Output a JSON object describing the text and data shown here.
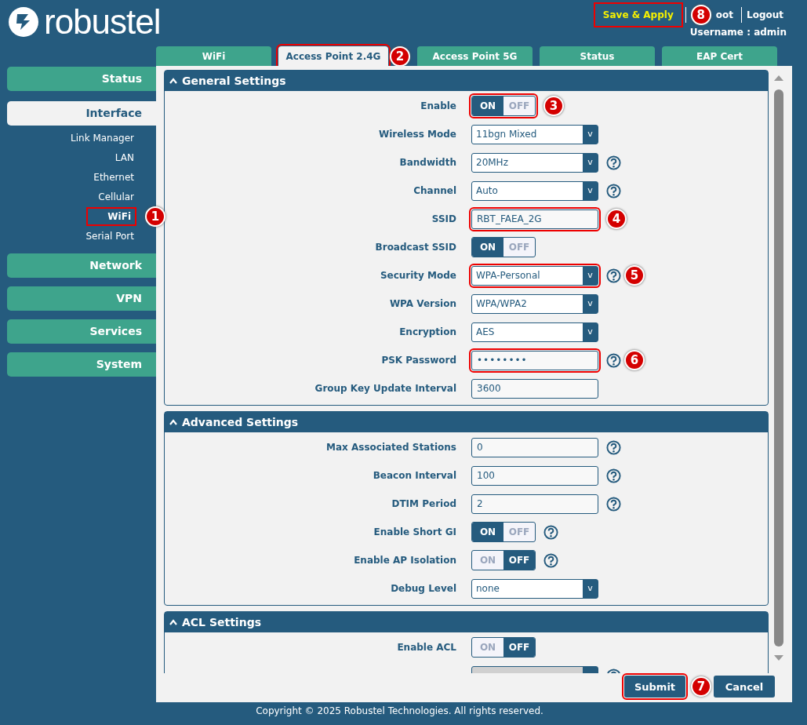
{
  "header": {
    "logo": "robustel",
    "save_apply": {
      "label": "Save & Apply",
      "callout": "8"
    },
    "reboot": "oot",
    "logout": "Logout",
    "username": "Username : admin"
  },
  "tabs": [
    {
      "label": "WiFi",
      "selected": false
    },
    {
      "label": "Access Point 2.4G",
      "selected": true,
      "callout": "2"
    },
    {
      "label": "Access Point 5G",
      "selected": false
    },
    {
      "label": "Status",
      "selected": false
    },
    {
      "label": "EAP Cert",
      "selected": false
    }
  ],
  "sidebar": {
    "items": [
      {
        "label": "Status",
        "selected": false
      },
      {
        "label": "Interface",
        "selected": true,
        "children": [
          {
            "label": "Link Manager",
            "selected": false
          },
          {
            "label": "LAN",
            "selected": false
          },
          {
            "label": "Ethernet",
            "selected": false
          },
          {
            "label": "Cellular",
            "selected": false
          },
          {
            "label": "WiFi",
            "selected": true,
            "callout": "1"
          },
          {
            "label": "Serial Port",
            "selected": false
          }
        ]
      },
      {
        "label": "Network",
        "selected": false
      },
      {
        "label": "VPN",
        "selected": false
      },
      {
        "label": "Services",
        "selected": false
      },
      {
        "label": "System",
        "selected": false
      }
    ]
  },
  "sections": [
    {
      "title": "General Settings",
      "expanded": true,
      "fields": [
        {
          "kind": "toggle",
          "label": "Enable",
          "on": true,
          "on_label": "ON",
          "off_label": "OFF",
          "callout": "3"
        },
        {
          "kind": "select",
          "label": "Wireless Mode",
          "value": "11bgn Mixed",
          "caret": "v"
        },
        {
          "kind": "select",
          "label": "Bandwidth",
          "value": "20MHz",
          "caret": "v",
          "help": true
        },
        {
          "kind": "select",
          "label": "Channel",
          "value": "Auto",
          "caret": "v",
          "help": true
        },
        {
          "kind": "input",
          "label": "SSID",
          "value": "RBT_FAEA_2G",
          "callout": "4"
        },
        {
          "kind": "toggle",
          "label": "Broadcast SSID",
          "on": true,
          "on_label": "ON",
          "off_label": "OFF"
        },
        {
          "kind": "select",
          "label": "Security Mode",
          "value": "WPA-Personal",
          "caret": "v",
          "help": true,
          "callout": "5"
        },
        {
          "kind": "select",
          "label": "WPA Version",
          "value": "WPA/WPA2",
          "caret": "v"
        },
        {
          "kind": "select",
          "label": "Encryption",
          "value": "AES",
          "caret": "v"
        },
        {
          "kind": "password",
          "label": "PSK Password",
          "value": "••••••••",
          "help": true,
          "callout": "6"
        },
        {
          "kind": "input",
          "label": "Group Key Update Interval",
          "value": "3600"
        }
      ]
    },
    {
      "title": "Advanced Settings",
      "expanded": true,
      "fields": [
        {
          "kind": "input",
          "label": "Max Associated Stations",
          "value": "0",
          "help": true
        },
        {
          "kind": "input",
          "label": "Beacon Interval",
          "value": "100",
          "help": true
        },
        {
          "kind": "input",
          "label": "DTIM Period",
          "value": "2",
          "help": true
        },
        {
          "kind": "toggle",
          "label": "Enable Short GI",
          "on": true,
          "on_label": "ON",
          "off_label": "OFF",
          "help": true
        },
        {
          "kind": "toggle",
          "label": "Enable AP Isolation",
          "on": false,
          "on_label": "ON",
          "off_label": "OFF",
          "help": true
        },
        {
          "kind": "select",
          "label": "Debug Level",
          "value": "none",
          "caret": "v"
        }
      ]
    },
    {
      "title": "ACL Settings",
      "expanded": true,
      "fields": [
        {
          "kind": "toggle",
          "label": "Enable ACL",
          "on": false,
          "on_label": "ON",
          "off_label": "OFF"
        },
        {
          "kind": "select",
          "disabled": true,
          "help": true
        }
      ]
    }
  ],
  "buttons": [
    {
      "label": "Submit",
      "kind": "primary",
      "callout": "7"
    },
    {
      "label": "Cancel",
      "kind": "secondary"
    }
  ],
  "footer": "Copyright © 2025 Robustel Technologies. All rights reserved."
}
